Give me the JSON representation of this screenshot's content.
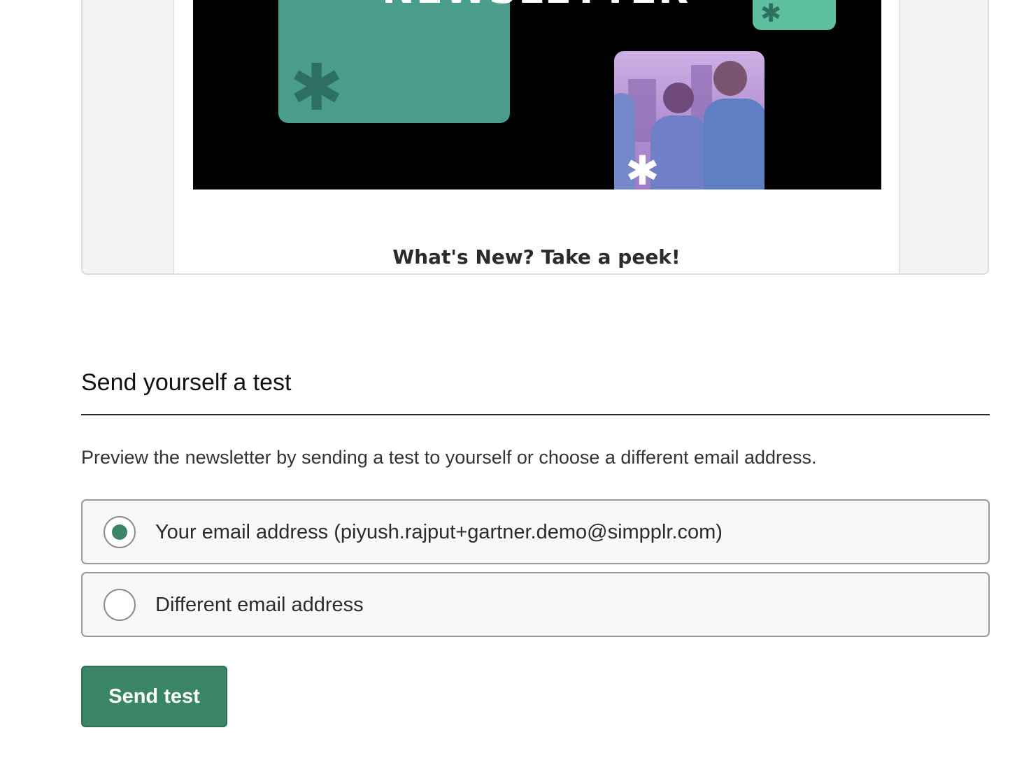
{
  "preview": {
    "banner_title": "NEWSLETTER",
    "heading": "What's New? Take a peek!"
  },
  "send_test": {
    "title": "Send yourself a test",
    "description": "Preview the newsletter by sending a test to yourself or choose a different email address.",
    "options": [
      {
        "label": "Your email address (piyush.rajput+gartner.demo@simpplr.com)",
        "checked": true
      },
      {
        "label": "Different email address",
        "checked": false
      }
    ],
    "button_label": "Send test"
  },
  "colors": {
    "accent": "#3a8565",
    "banner_green": "#4a9d8a",
    "banner_light_green": "#5dbf9e",
    "banner_background": "#000000",
    "photo_tint": "#b592d4"
  },
  "icons": {
    "banner_decor": "asterisk-icon"
  }
}
